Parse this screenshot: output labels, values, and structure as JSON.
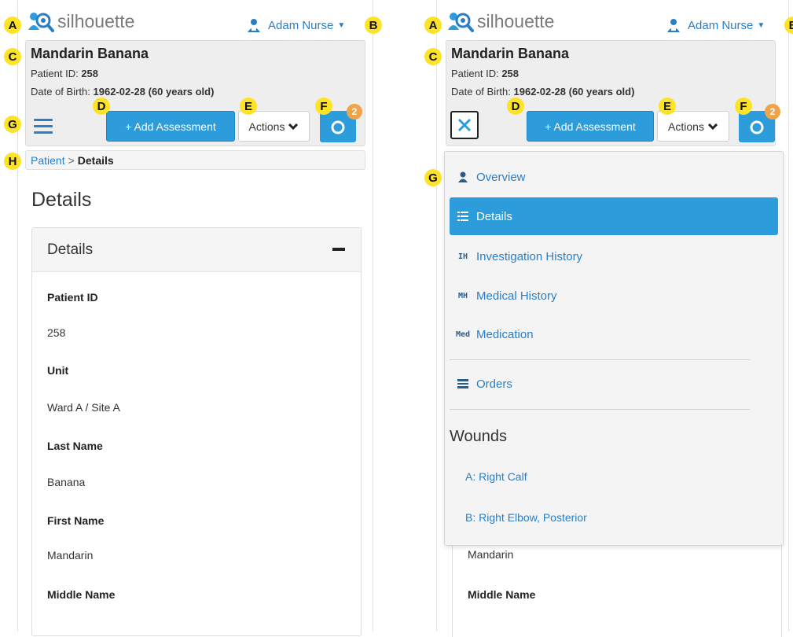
{
  "app": {
    "brand_name": "silhouette"
  },
  "user": {
    "name": "Adam Nurse"
  },
  "patient": {
    "name": "Mandarin Banana",
    "id_label": "Patient ID:",
    "id_value": "258",
    "dob_label": "Date of Birth:",
    "dob_value": "1962-02-28 (60 years old)"
  },
  "toolbar": {
    "add_assessment_label": "+ Add Assessment",
    "actions_label": "Actions",
    "camera_badge": "2"
  },
  "breadcrumb": {
    "parent": "Patient",
    "separator": ">",
    "current": "Details"
  },
  "page": {
    "title": "Details"
  },
  "details_panel": {
    "title": "Details",
    "fields": [
      {
        "label": "Patient ID",
        "value": "258"
      },
      {
        "label": "Unit",
        "value": "Ward A / Site A"
      },
      {
        "label": "Last Name",
        "value": "Banana"
      },
      {
        "label": "First Name",
        "value": "Mandarin"
      },
      {
        "label": "Middle Name",
        "value": ""
      }
    ]
  },
  "nav_menu": {
    "items": [
      {
        "label": "Overview",
        "icon": "person-icon"
      },
      {
        "label": "Details",
        "icon": "list-icon",
        "active": true
      },
      {
        "label": "Investigation History",
        "icon_text": "IH"
      },
      {
        "label": "Medical History",
        "icon_text": "MH"
      },
      {
        "label": "Medication",
        "icon_text": "Med"
      }
    ],
    "orders_label": "Orders",
    "wounds_heading": "Wounds",
    "wounds": [
      "A: Right Calf",
      "B: Right Elbow, Posterior"
    ]
  },
  "right_background": {
    "first_name_value": "Mandarin",
    "middle_name_label": "Middle Name"
  },
  "callouts": [
    "A",
    "B",
    "C",
    "D",
    "E",
    "F",
    "G",
    "H"
  ],
  "colors": {
    "accent": "#2d9cdb",
    "link": "#2a7ec6",
    "callout": "#fde327",
    "badge": "#f0a44a"
  }
}
